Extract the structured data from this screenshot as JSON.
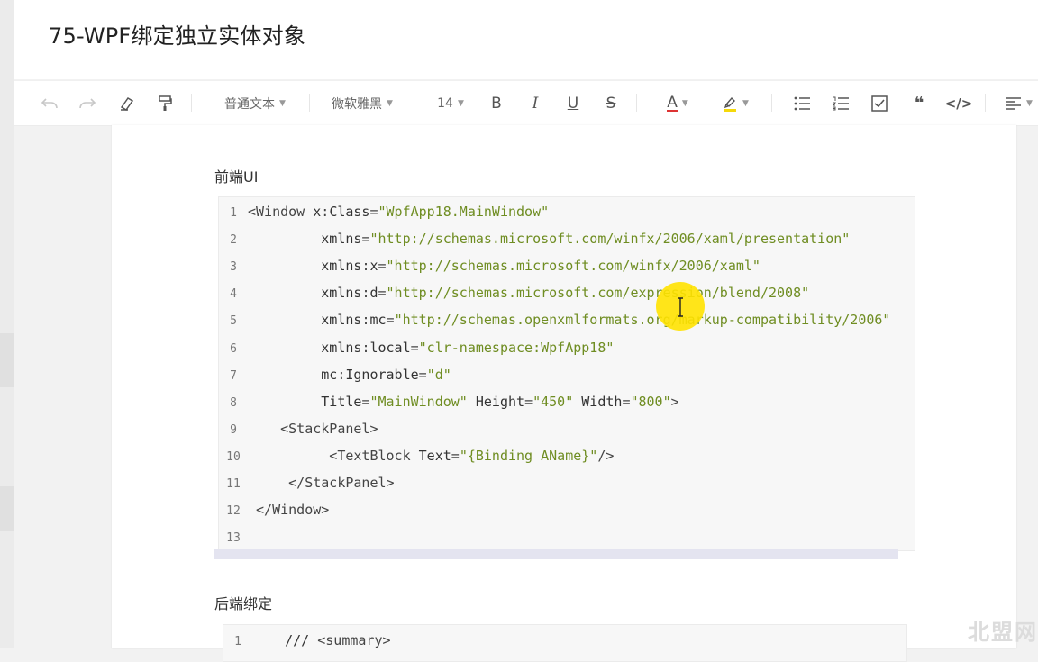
{
  "document": {
    "title": "75-WPF绑定独立实体对象"
  },
  "toolbar": {
    "paragraph_style": "普通文本",
    "font_family": "微软雅黑",
    "font_size": "14",
    "bold": "B",
    "italic": "I",
    "underline": "U",
    "strike": "S",
    "font_color": "A",
    "code_label": "</>",
    "quote_label": "❝",
    "icons": [
      "undo-icon",
      "redo-icon",
      "eraser-icon",
      "format-painter-icon",
      "bold-icon",
      "italic-icon",
      "underline-icon",
      "strikethrough-icon",
      "font-color-icon",
      "highlight-icon",
      "bulleted-list-icon",
      "numbered-list-icon",
      "checkbox-icon",
      "quote-icon",
      "code-icon",
      "align-icon"
    ]
  },
  "sections": {
    "frontend_heading": "前端UI",
    "backend_heading": "后端绑定"
  },
  "code1": {
    "lines": [
      {
        "n": "1",
        "parts": [
          [
            "pun",
            "<"
          ],
          [
            "tag",
            "Window "
          ],
          [
            "att",
            "x"
          ],
          [
            "pun",
            ":"
          ],
          [
            "att",
            "Class"
          ],
          [
            "pun",
            "="
          ],
          [
            "str",
            "\"WpfApp18.MainWindow\""
          ]
        ]
      },
      {
        "n": "2",
        "parts": [
          [
            "att",
            "         xmlns"
          ],
          [
            "pun",
            "="
          ],
          [
            "str",
            "\"http://schemas.microsoft.com/winfx/2006/xaml/presentation\""
          ]
        ]
      },
      {
        "n": "3",
        "parts": [
          [
            "att",
            "         xmlns"
          ],
          [
            "pun",
            ":"
          ],
          [
            "att",
            "x"
          ],
          [
            "pun",
            "="
          ],
          [
            "str",
            "\"http://schemas.microsoft.com/winfx/2006/xaml\""
          ]
        ]
      },
      {
        "n": "4",
        "parts": [
          [
            "att",
            "         xmlns"
          ],
          [
            "pun",
            ":"
          ],
          [
            "att",
            "d"
          ],
          [
            "pun",
            "="
          ],
          [
            "str",
            "\"http://schemas.microsoft.com/expression/blend/2008\""
          ]
        ]
      },
      {
        "n": "5",
        "parts": [
          [
            "att",
            "         xmlns"
          ],
          [
            "pun",
            ":"
          ],
          [
            "att",
            "mc"
          ],
          [
            "pun",
            "="
          ],
          [
            "str",
            "\"http://schemas.openxmlformats.org/markup-compatibility/2006\""
          ]
        ]
      },
      {
        "n": "6",
        "parts": [
          [
            "att",
            "         xmlns"
          ],
          [
            "pun",
            ":"
          ],
          [
            "att",
            "local"
          ],
          [
            "pun",
            "="
          ],
          [
            "str",
            "\"clr-namespace:WpfApp18\""
          ]
        ]
      },
      {
        "n": "7",
        "parts": [
          [
            "att",
            "         mc"
          ],
          [
            "pun",
            ":"
          ],
          [
            "att",
            "Ignorable"
          ],
          [
            "pun",
            "="
          ],
          [
            "str",
            "\"d\""
          ]
        ]
      },
      {
        "n": "8",
        "parts": [
          [
            "att",
            "         Title"
          ],
          [
            "pun",
            "="
          ],
          [
            "str",
            "\"MainWindow\""
          ],
          [
            "att",
            " Height"
          ],
          [
            "pun",
            "="
          ],
          [
            "str",
            "\"450\""
          ],
          [
            "att",
            " Width"
          ],
          [
            "pun",
            "="
          ],
          [
            "str",
            "\"800\""
          ],
          [
            "pun",
            ">"
          ]
        ]
      },
      {
        "n": "9",
        "parts": [
          [
            "pun",
            "    <"
          ],
          [
            "tag",
            "StackPanel"
          ],
          [
            "pun",
            ">"
          ]
        ]
      },
      {
        "n": "10",
        "parts": [
          [
            "pun",
            "          <"
          ],
          [
            "tag",
            "TextBlock "
          ],
          [
            "att",
            "Text"
          ],
          [
            "pun",
            "="
          ],
          [
            "str",
            "\"{Binding AName}\""
          ],
          [
            "pun",
            "/>"
          ]
        ]
      },
      {
        "n": "11",
        "parts": [
          [
            "pun",
            "     </"
          ],
          [
            "tag",
            "StackPanel"
          ],
          [
            "pun",
            ">"
          ]
        ]
      },
      {
        "n": "12",
        "parts": [
          [
            "pun",
            " </"
          ],
          [
            "tag",
            "Window"
          ],
          [
            "pun",
            ">"
          ]
        ]
      },
      {
        "n": "13",
        "parts": []
      }
    ]
  },
  "code2": {
    "lines": [
      {
        "n": "1",
        "parts": [
          [
            "att",
            "    /// "
          ],
          [
            "pun",
            "<"
          ],
          [
            "tag",
            "summary"
          ],
          [
            "pun",
            ">"
          ]
        ]
      }
    ]
  },
  "watermark": "北盟网"
}
